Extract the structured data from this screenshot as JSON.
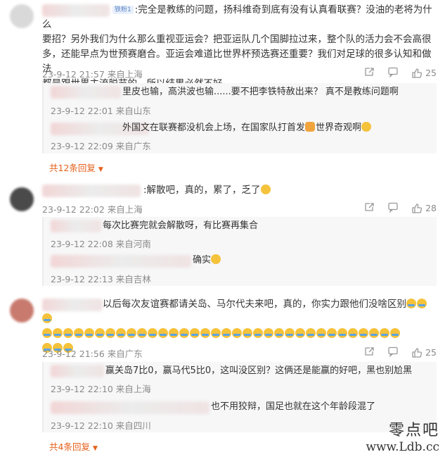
{
  "comments": [
    {
      "badge": "铁粉1",
      "text": ":完全是教练的问题，扬科维奇到底有没有认真看联赛？没油的老将为什么要招？另外我们为什么那么重视亚运会？把亚运队几个国脚拉过来，整个队的活力会不会高很多，还能早点为世预赛磨合。亚运会难道比世界杯预选赛还重要？我们对足球的很多认知和做法都是跟世界主流脱节的，所以结果必然不好。",
      "line1": ":完全是教练的问题，扬科维奇到底有没有认真看联赛？没油的老将为什么",
      "line2": "要招？另外我们为什么那么重视亚运会？把亚运队几个国脚拉过来，整个队的活力会不会高很",
      "line3": "多，还能早点为世预赛磨合。亚运会难道比世界杯预选赛还重要？我们对足球的很多认知和做法",
      "line4": "都是跟世界主流脱节的，所以结果必然不好。",
      "time": "23-9-12 21:57 来自上海",
      "likes": "25",
      "replies": [
        {
          "text": "里皮也输，高洪波也输......要不把李铁特赦出来？ 真不是教练问题啊",
          "time": "23-9-12 22:01 来自山东"
        },
        {
          "text": "外国文在联赛都没机会上场，在国家队打首发",
          "text2": "世界奇观啊",
          "time": "23-9-12 22:09 来自广东"
        }
      ],
      "more": "共12条回复"
    },
    {
      "text": ":解散吧，真的，累了，乏了",
      "time": "23-9-12 22:02 来自上海",
      "likes": "28",
      "replies": [
        {
          "text": "每次比赛完就会解散呀，有比赛再集合",
          "time": "23-9-12 22:08 来自河南"
        },
        {
          "text": "确实",
          "time": "23-9-12 22:13 来自吉林"
        }
      ]
    },
    {
      "text": "以后每次友谊赛都请关岛、马尔代夫来吧，真的，你实力跟他们没啥区别",
      "time": "23-9-12 21:56 来自广东",
      "likes": "25",
      "replies": [
        {
          "text": "赢关岛7比0，赢马代5比0，这叫没区别？这俩还是能赢的好吧，黑也别尬黑",
          "time": "23-9-12 22:10 来自上海"
        },
        {
          "text": "也不用狡辩，国足也就在这个年龄段混了",
          "time": "23-9-12 22:10 来自四川"
        }
      ],
      "more": "共4条回复"
    }
  ],
  "watermark": {
    "line1": "零点吧",
    "line2": "www.Ldb.cc"
  }
}
